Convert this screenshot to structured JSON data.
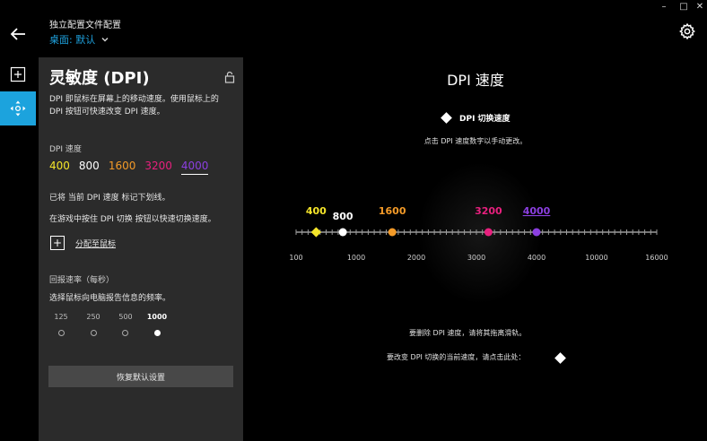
{
  "window": {
    "controls": [
      "–",
      "□",
      "✕"
    ]
  },
  "header": {
    "profile_title": "独立配置文件配置",
    "profile_subtitle": "桌面: 默认"
  },
  "panel": {
    "title": "灵敏度 (DPI)",
    "description": "DPI 即鼠标在屏幕上的移动速度。使用鼠标上的 DPI 按钮可快速改变 DPI 速度。",
    "dpi_label": "DPI 速度",
    "dpi_values": [
      {
        "label": "400",
        "color": "#f5e52a"
      },
      {
        "label": "800",
        "color": "#ffffff"
      },
      {
        "label": "1600",
        "color": "#f39a28"
      },
      {
        "label": "3200",
        "color": "#e8207e"
      },
      {
        "label": "4000",
        "color": "#8b3fe0",
        "selected": true
      }
    ],
    "note1": "已将 当前 DPI 速度 标记下划线。",
    "note2": "在游戏中按住 DPI 切换 按钮以快速切换速度。",
    "assign_label": "分配至鼠标",
    "rate_label": "回报速率（每秒）",
    "rate_desc": "选择鼠标向电脑报告信息的频率。",
    "rates": [
      {
        "label": "125",
        "selected": false
      },
      {
        "label": "250",
        "selected": false
      },
      {
        "label": "500",
        "selected": false
      },
      {
        "label": "1000",
        "selected": true
      }
    ],
    "restore_button": "恢复默认设置"
  },
  "main": {
    "title": "DPI 速度",
    "shift_label": "DPI 切换速度",
    "hint": "点击 DPI 速度数字以手动更改。",
    "delete_note": "要删除 DPI 速度，请将其拖离滑轨。",
    "change_note": "要改变 DPI 切换的当前速度，请点击此处："
  },
  "chart_data": {
    "type": "scatter",
    "axis_ticks": [
      "100",
      "1000",
      "2000",
      "3000",
      "4000",
      "10000",
      "16000"
    ],
    "markers": [
      {
        "label": "400",
        "value": 400,
        "color": "#f5e52a",
        "shape": "diamond"
      },
      {
        "label": "800",
        "value": 800,
        "color": "#ffffff",
        "shape": "circle"
      },
      {
        "label": "1600",
        "value": 1600,
        "color": "#f39a28",
        "shape": "circle"
      },
      {
        "label": "3200",
        "value": 3200,
        "color": "#e8207e",
        "shape": "circle"
      },
      {
        "label": "4000",
        "value": 4000,
        "color": "#8b3fe0",
        "shape": "circle",
        "current": true
      }
    ]
  }
}
